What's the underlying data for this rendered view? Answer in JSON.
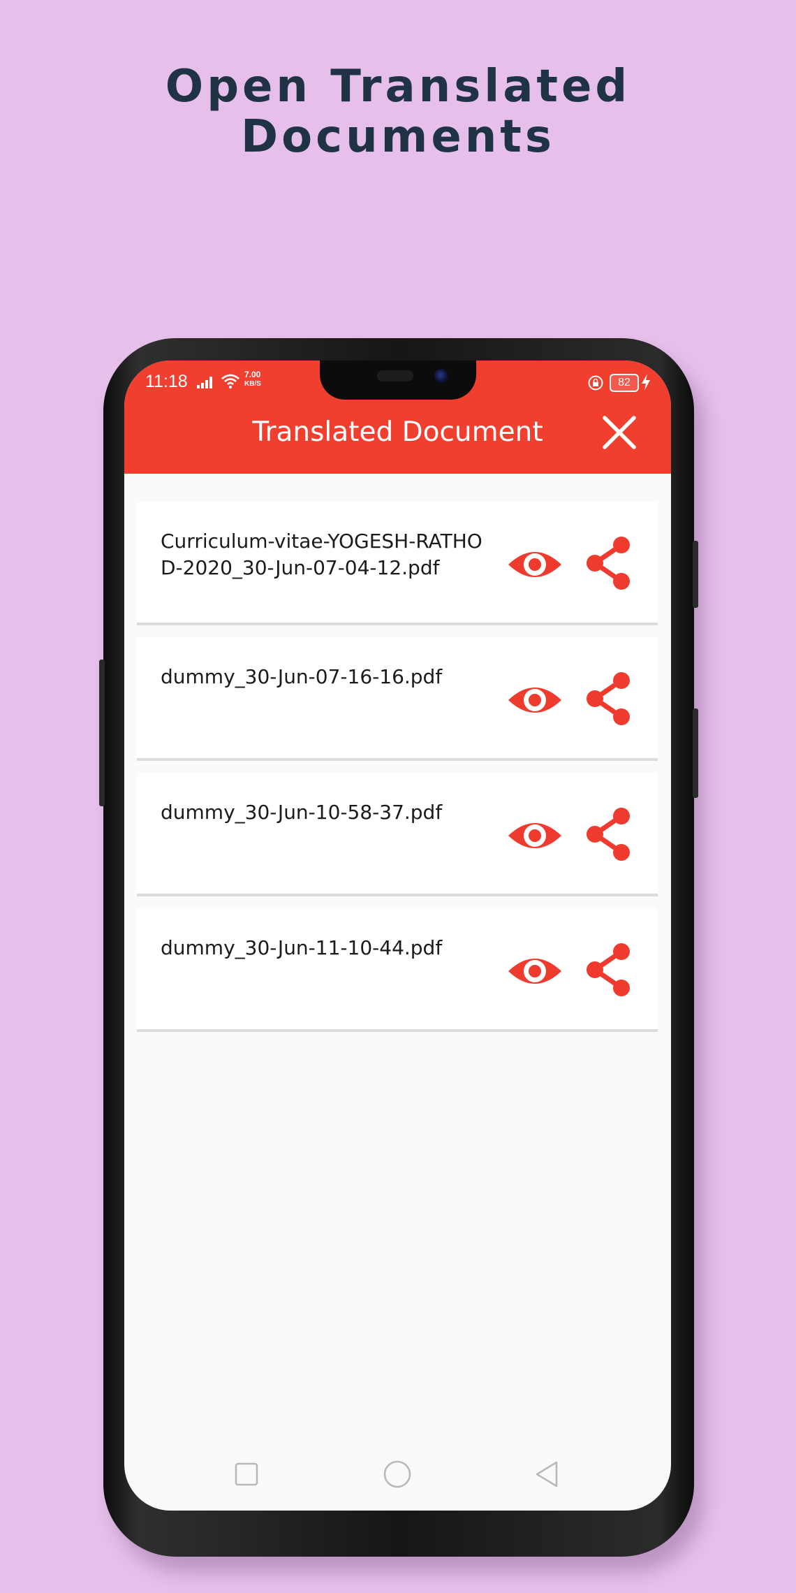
{
  "promo": {
    "title_line1": "Open Translated",
    "title_line2": "Documents"
  },
  "status_bar": {
    "time": "11:18",
    "net_speed_value": "7.00",
    "net_speed_unit": "KB/S",
    "battery": "82"
  },
  "appbar": {
    "title": "Translated Document",
    "close_icon": "close-icon"
  },
  "documents": [
    {
      "name": "Curriculum-vitae-YOGESH-RATHOD-2020_30-Jun-07-04-12.pdf"
    },
    {
      "name": "dummy_30-Jun-07-16-16.pdf"
    },
    {
      "name": "dummy_30-Jun-10-58-37.pdf"
    },
    {
      "name": "dummy_30-Jun-11-10-44.pdf"
    }
  ],
  "icons": {
    "view": "eye-icon",
    "share": "share-icon",
    "nav_recent": "square-icon",
    "nav_home": "circle-icon",
    "nav_back": "triangle-back-icon"
  },
  "colors": {
    "background": "#e6bfea",
    "accent": "#f03f2f",
    "title_text": "#1f3344"
  }
}
